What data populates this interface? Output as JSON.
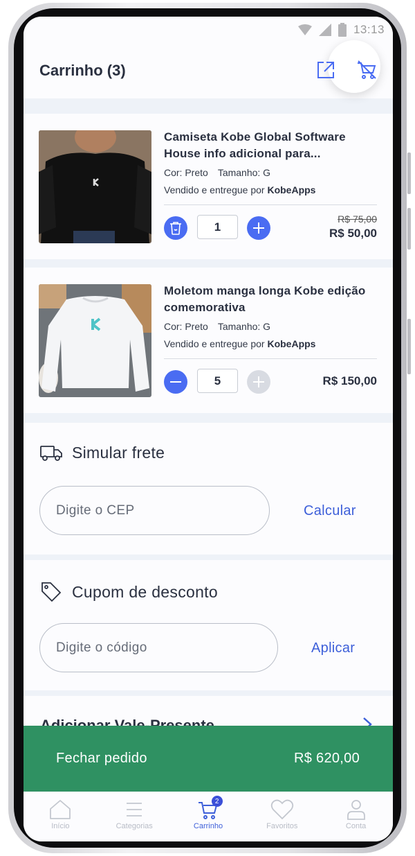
{
  "status": {
    "time": "13:13"
  },
  "header": {
    "title": "Carrinho (3)"
  },
  "cart": {
    "items": [
      {
        "title": "Camiseta Kobe Global Software House info adicional para...",
        "color": "Cor: Preto",
        "size": "Tamanho: G",
        "seller_prefix": "Vendido e entregue por",
        "seller": "KobeApps",
        "quantity": "1",
        "old_price": "R$ 75,00",
        "price": "R$ 50,00"
      },
      {
        "title": "Moletom manga longa Kobe edição comemorativa",
        "color": "Cor: Preto",
        "size": "Tamanho: G",
        "seller_prefix": "Vendido e entregue por",
        "seller": "KobeApps",
        "quantity": "5",
        "price": "R$ 150,00"
      }
    ]
  },
  "shipping": {
    "title": "Simular frete",
    "placeholder": "Digite o CEP",
    "action": "Calcular"
  },
  "coupon": {
    "title": "Cupom de desconto",
    "placeholder": "Digite o código",
    "action": "Aplicar"
  },
  "gift": {
    "title": "Adicionar Vale-Presente"
  },
  "checkout": {
    "label": "Fechar pedido",
    "total": "R$ 620,00"
  },
  "tabs": [
    {
      "label": "Início",
      "icon": "home-icon"
    },
    {
      "label": "Categorias",
      "icon": "menu-icon"
    },
    {
      "label": "Carrinho",
      "icon": "cart-icon",
      "badge": "2",
      "active": true
    },
    {
      "label": "Favoritos",
      "icon": "heart-icon"
    },
    {
      "label": "Conta",
      "icon": "user-icon"
    }
  ],
  "colors": {
    "accent": "#4a6cf2",
    "link": "#3d5fd9",
    "checkout": "#2f9162",
    "text": "#2a3040"
  }
}
